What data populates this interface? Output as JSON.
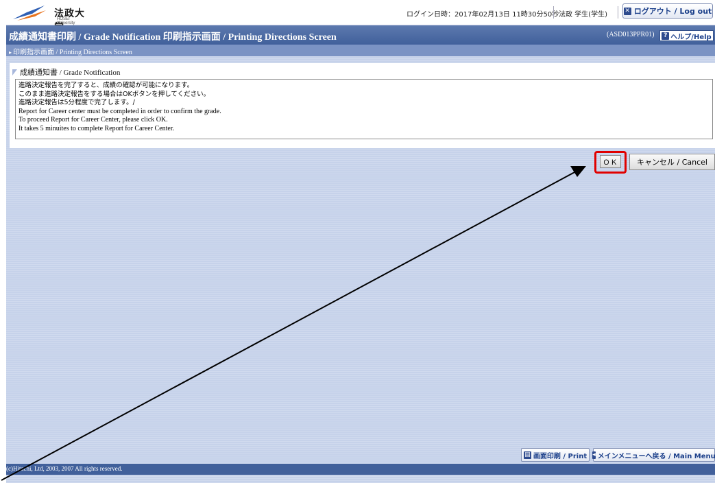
{
  "header": {
    "logo_text": "法政大学",
    "logo_subtext": "HOSEI University",
    "login_info": "ログイン日時：2017年02月13日 11時30分50秒",
    "user_name": "法政 学生(学生)",
    "logout_label": "ログアウト / Log out"
  },
  "title_bar": {
    "title": "成績通知書印刷 / Grade Notification  印刷指示画面 / Printing Directions Screen",
    "screen_id": "(ASD013PPR01)",
    "help_label": "ヘルプ/Help"
  },
  "breadcrumb": {
    "label": "印刷指示画面 / Printing Directions Screen"
  },
  "section": {
    "title": "成績通知書 / Grade Notification"
  },
  "message": {
    "lines": [
      "進路決定報告を完了すると、成績の確認が可能になります。",
      "このまま進路決定報告をする場合はOKボタンを押してください。",
      "進路決定報告は5分程度で完了します。/",
      "Report for Career center must be completed in order to confirm the grade.",
      "To proceed Report for Career Center, please click OK.",
      "It takes 5 minuites to complete Report for Career Center."
    ]
  },
  "buttons": {
    "ok_label": "ＯＫ",
    "cancel_label": "キャンセル / Cancel",
    "print_label": "画面印刷 / Print",
    "main_menu_label": "メインメニューへ戻る / Main Menu"
  },
  "footer": {
    "copyright": "(c)Hitachi, Ltd, 2003, 2007 All rights reserved."
  },
  "colors": {
    "title_bar": "#41609b",
    "breadcrumb_bar": "#7b93c4",
    "background": "#c6d2ea",
    "highlight": "#e00000",
    "annotation_arrow": "#000000"
  },
  "icons": {
    "logo": "hosei-logo-icon",
    "logout": "logout-icon",
    "help": "help-icon",
    "print": "print-icon",
    "main_menu": "return-icon",
    "section": "section-flag-icon"
  }
}
